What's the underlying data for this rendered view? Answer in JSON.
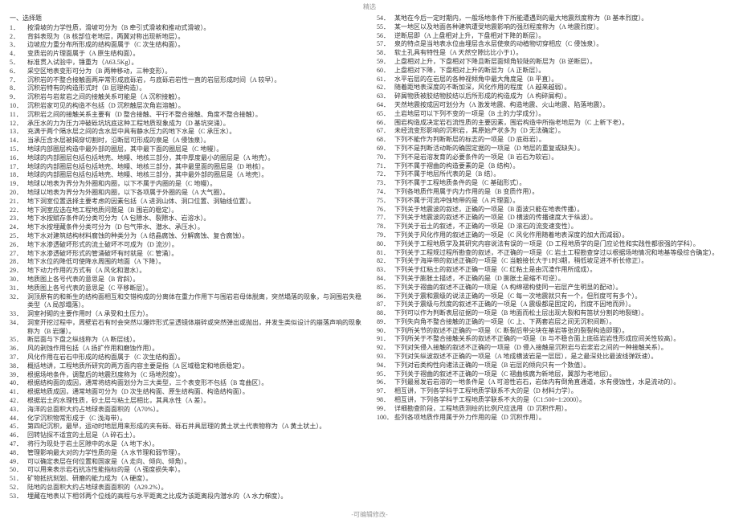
{
  "header_text": "精选",
  "footer_text": "-可编辑修改-",
  "section_title": "一、选择题",
  "items": [
    {
      "n": "1．",
      "t": "按滑坡的力学性质，滑坡可分为（B 牵引式滑坡和推动式滑坡）。"
    },
    {
      "n": "2．",
      "t": "背斜表现为（B 核部位老地层，两翼对称出现新地层）。"
    },
    {
      "n": "3．",
      "t": "边坡应力重分布所形成的结构面属于（C 次生结构面）。"
    },
    {
      "n": "4．",
      "t": "变质岩的片理面属于（A 原生结构面）。"
    },
    {
      "n": "5．",
      "t": "标准贯入试验中，锤重为（A63.5Kg）。"
    },
    {
      "n": "6．",
      "t": "采空区地表变形可分为（B 两种移动，三种变形）。"
    },
    {
      "n": "7．",
      "t": "沉积岩的不整合接触面两岸常形成底砾岩，与底砾岩岩性一直的岩层形成时间（A 较早）。"
    },
    {
      "n": "8．",
      "t": "沉积岩特有的构造形式时（B 层理构造）。"
    },
    {
      "n": "9．",
      "t": "沉积岩与岩浆岩之间的接触关系可能是（A 沉积接触）。"
    },
    {
      "n": "10．",
      "t": "沉积岩家可见的构造不包括（D 沉积触层次角岩溶触）。"
    },
    {
      "n": "11．",
      "t": "沉积岩之间的接触关系主要有（D 整合接触、平行不整合接触、角度不整合接触）。"
    },
    {
      "n": "12．",
      "t": "承压水的力为压力冲破砾坑坑底这种工程地质现象成为（D 基坑突涌）。"
    },
    {
      "n": "13．",
      "t": "充满于两个隔水层之间的含水层中具有静水压力的地下水是（C 承压水）。"
    },
    {
      "n": "14．",
      "t": "当承压含水层被揭穿切割时，沿断层可形成的泉是（A 侵蚀泉）。"
    },
    {
      "n": "15．",
      "t": "地球内部圈层构造中最外部的圈层，其中最下面的圈层是（C 地幔）。"
    },
    {
      "n": "16．",
      "t": "地球的内部圈层包括包括地壳、地幔、地核三部分，其中厚度最小的圈层是（A 地壳）。"
    },
    {
      "n": "17．",
      "t": "地球的内部圈层包括包括地壳、地幔、地核三部分，其中最里面的圈层是（D 地核）。"
    },
    {
      "n": "18．",
      "t": "地球的内部圈层包括包括地壳、地幔、地核三部分，其中最外部的圈层是（A 地壳）。"
    },
    {
      "n": "19．",
      "t": "地球以地表为界分为外圈和内圈，以下不属于内圈的是（C 地幔）。"
    },
    {
      "n": "20．",
      "t": "地球以地表为界分为外圈和内圈，以下各项属于外圈的是（A 大气圈）。"
    },
    {
      "n": "21．",
      "t": "地下洞室位置选择主要考虑的因素包括（A 进洞山体、洞口位置、洞轴线位置）。"
    },
    {
      "n": "22．",
      "t": "地下洞室应选在地工程地质问题是（B 围岩的稳定）。"
    },
    {
      "n": "23．",
      "t": "地下水按赋存条件的分类可分为（A 包隙水、裂隙水、岩溶水）。"
    },
    {
      "n": "24．",
      "t": "地下水按埋藏条件分类可分为（D 包气带水、潜水、承压水）。"
    },
    {
      "n": "25．",
      "t": "地下水对建筑结构材料腐蚀的种类分为（A 结晶腐蚀、分解腐蚀、复合腐蚀）。"
    },
    {
      "n": "26．",
      "t": "地下水渗透破坏形式的流土破坏不可成为（D 流沙）。"
    },
    {
      "n": "27．",
      "t": "地下水渗透破坏形式的管涌破坏有时就是（C 管涌）。"
    },
    {
      "n": "28．",
      "t": "地下水位的降低可使降水周围的地面（A 下降）。"
    },
    {
      "n": "29．",
      "t": "地下动力作用的方式有（A 风化和潜水）。"
    },
    {
      "n": "30．",
      "t": "地质图上各号代表的意思是（B 背斜）。"
    },
    {
      "n": "31．",
      "t": "地质图上各号代表的意思是（C 平移断层）。"
    },
    {
      "n": "32．",
      "t": "洞顶原有的和新生的结构面相互和交错构成的分离体在重力作用下与围岩岩母体脱离，突然塌落的现象，与洞围岩失稳类型（A 局部塌落）。"
    },
    {
      "n": "33．",
      "t": "洞室衬砌的主要作用时（A 承受和土压力）。"
    },
    {
      "n": "34．",
      "t": "洞室开挖过程中，周壁岩石有时会突然以爆炸形式呈透镜体崩碎或突然弹出或抛出，并发生类似设计的崩落声响的现象称为（B 岩爆）。"
    },
    {
      "n": "35．",
      "t": "断层面与下盘之纵线称为（A 断层线）。"
    },
    {
      "n": "36．",
      "t": "风的剥蚀作用包括（A 扬扩作用和磨蚀作用）。"
    },
    {
      "n": "37．",
      "t": "风化作用在岩石中形成的结构面属于（C 次生结构面）。"
    },
    {
      "n": "38．",
      "t": "概括地讲，工程地质所研究的两方面内容主要是指（A 区域稳定和地质稳定）。"
    },
    {
      "n": "39．",
      "t": "根据场地条件，调整后的地震烈度称为（C 场地烈度）。"
    },
    {
      "n": "40．",
      "t": "根据结构面的成因，通常将结构面划分为三大类型，三个表变形不包括（B 弯曲区）。"
    },
    {
      "n": "41．",
      "t": "根据地质成因，通常地面可分为（D 次生结构面、原生结构面、构造结构面）。"
    },
    {
      "n": "42．",
      "t": "根据岩土的水理性质，砂土层与粘土层相比，其具水性（A 差）。"
    },
    {
      "n": "43．",
      "t": "海洋的总面积大约占地球表面面积的（A70%）。"
    },
    {
      "n": "44．",
      "t": "化学沉积物常形成于（C 浅海带）。"
    },
    {
      "n": "45．",
      "t": "第四纪沉积，最早，运动时地层用来形成的夹有砾、砾石并具层理的黄土状土代表物称为（A 黄土状土）。"
    },
    {
      "n": "46．",
      "t": "回转钻探不适宜的土层是（A 碎石土）。"
    },
    {
      "n": "47．",
      "t": "将行为现处于岩土区隙中的水是（A 地下水）。"
    },
    {
      "n": "48．",
      "t": "管理影响最大对的力学性质的是（A 水节理和弱节理）。"
    },
    {
      "n": "49．",
      "t": "可以确定表层在何位置和国家是（A 走向、倾向、倾角）。"
    },
    {
      "n": "50．",
      "t": "可以用来表示岩石抗冻性能指标的是（A 强度损失率）。"
    },
    {
      "n": "51．",
      "t": "矿物抵抗刻划、研磨的能力成为（A 硬度）。"
    },
    {
      "n": "52．",
      "t": "陆地的总面积大约占地球表面面积的（A29.2%）。"
    },
    {
      "n": "53．",
      "t": "埋藏在地表以下相邻两个位线的高程与水平距离之比成为该距离段内潜水的（A 水力梯度）。"
    },
    {
      "n": "54．",
      "t": "某地在今后一定时期内，一般场地条件下所能遭遇到的最大地震烈度称为（B 基本烈度）。"
    },
    {
      "n": "55．",
      "t": "某一地区以及地面各种建筑遭受地震影响的强烈程度称为（A 地震烈度）。"
    },
    {
      "n": "56．",
      "t": "逆断层即（A 上盘相对上升，下盘相对下降的断层）。"
    },
    {
      "n": "57．",
      "t": "泉的特点是当地表水位由埋层含水层使泉的动植物切穿相应（C 侵蚀泉）。"
    },
    {
      "n": "58．",
      "t": "软土孔具有特性是（A 天然空隙比比小于1）。"
    },
    {
      "n": "59．",
      "t": "上盘相对上升，下盘相对下降且断层面倾角较陡的断层为（B 逆断层）。"
    },
    {
      "n": "60．",
      "t": "上盘相对下降，下盘相对上升的断层为（A 正断层）。"
    },
    {
      "n": "61．",
      "t": "水平岩层的在岩层的各种视倾角中最大角度是（B 平直）。"
    },
    {
      "n": "62．",
      "t": "随着距地表深度的不断加深，风化作用的程度（A 越来越弱）。"
    },
    {
      "n": "63．",
      "t": "碎屑物质被胶结物胶结以后所形成的构造成为（A 构碎屑构）。"
    },
    {
      "n": "64．",
      "t": "天然地震按成因可划分为（A 激发地震、构造地震、火山地震、陷落地震）。"
    },
    {
      "n": "65．",
      "t": "土岩地层可以下列不变的一项是（B 土的力学成分）。"
    },
    {
      "n": "66．",
      "t": "围岩构造成决定岩石流性质的主要因素，围岩构造中所指老地层为（C 上新下老）。"
    },
    {
      "n": "67．",
      "t": "未经流变形影响的沉积岩，其原始产状多为（D 无法确定）。"
    },
    {
      "n": "68．",
      "t": "下列不能作为判断断层的标志的一项是（D 底砾岩）。"
    },
    {
      "n": "69．",
      "t": "下列不是判断活动断的确固定据的一项是（D 地层的重复或缺失）。"
    },
    {
      "n": "70．",
      "t": "下列不是岩溶发育的必要条件的一项是（B 岩石为软岩）。"
    },
    {
      "n": "71．",
      "t": "下列不属于褶曲的构造要素的是（B 结构）。"
    },
    {
      "n": "72．",
      "t": "下列不属于地层所代表的是（B 结）。"
    },
    {
      "n": "73．",
      "t": "下列不属于工程地质条件的是（C 基础形式）。"
    },
    {
      "n": "74．",
      "t": "下列各地质作用属于内力作用的是（B 变质作用）。"
    },
    {
      "n": "75．",
      "t": "下列不属于河流冲蚀地带的是（A 片理面）。"
    },
    {
      "n": "76．",
      "t": "下列关于地震波的叙述，正确的一项是（B 面波只能在地表传播）。"
    },
    {
      "n": "77．",
      "t": "下列关于地震波的叙述不正确的一项是（D 横波的传播速度大于纵波）。"
    },
    {
      "n": "78．",
      "t": "下列关于岩土的叙述，不正确的一项是（D 滚石的流变速变性）。"
    },
    {
      "n": "79．",
      "t": "下列关于风化作用的叙述正确的一项是（C 风化作用随着地表深度的加大而减弱）。"
    },
    {
      "n": "80．",
      "t": "下列关于工程地质学及其研究内容说法有误的一项是（D 工程地质学的是门应论性和实践性都很强的学科）。"
    },
    {
      "n": "81．",
      "t": "下列关于工程规过程所勘查的叙述，不正确的一项是（C 岩土工程勘查穿过以根据场地情况和地基等级综合确定）。"
    },
    {
      "n": "82．",
      "t": "下列关于海岸带的叙述正确的一项是（C 当触接长大于1时3期，稍低坡足进不析长修正）。"
    },
    {
      "n": "83．",
      "t": "下列关于红粘土的叙述不正确一项是（C 红粘土是由沉渣作用所成成）。"
    },
    {
      "n": "84．",
      "t": "下列关于膨胀土描述，不正确的是（D 膨胀土是缩不可逆）。"
    },
    {
      "n": "85．",
      "t": "下列关于褶曲的叙述不正确的一项是（A 构绵褶构使同一岩层产生明显的配动）。"
    },
    {
      "n": "86．",
      "t": "下列关于震和震级的说法正确的一项是（C 每一次地震就只有一个，但烈度可有多个）。"
    },
    {
      "n": "87．",
      "t": "下列关于震级与烈度的叙述不正确的一项是（A 震级都是固定的，烈度不因地而异）。"
    },
    {
      "n": "88．",
      "t": "下列可以作为判断表层征据的一项是（B 地面而松土层出现大裂和有笛状分割的地裂缝）。"
    },
    {
      "n": "89．",
      "t": "下列失向角不整合接触的正确的一项是（C 上、下两套岩层之间无沉积间断）。"
    },
    {
      "n": "90．",
      "t": "下列所关节的叙述不正确的一项是（C 断裂后带尖块在基岩等张的裂裂构造即理）。"
    },
    {
      "n": "91．",
      "t": "下列所关于不整合接触关系的叙述不正确的一项是（B 与不稳合面上底砾岩岩性形成应间关性较高）。"
    },
    {
      "n": "92．",
      "t": "下列对矢侵入接触的叙述不正确的一项是（D 侵入接触是沉积岩与岩浆岩之间的一种接触关系）。"
    },
    {
      "n": "93．",
      "t": "下列对矢纵波叙述不正确的一项是（A 地成横波岩是一层层），是之最深处比最波线弹跃速）。"
    },
    {
      "n": "94．",
      "t": "下列对岩类构性向诸法正确的一项是（B 岩层的倾向只有一个数值）。"
    },
    {
      "n": "95．",
      "t": "下列关于褶曲的叙述不正确的一项是（C 褶曲核腐为新地层，翼部为老地层）。"
    },
    {
      "n": "96．",
      "t": "下列最易发岩岩溶的一地条件是（A 可溶性岩石，岩体内有倒角直通道，水有侵蚀性，水是流动的）。"
    },
    {
      "n": "97．",
      "t": "相互讲，下列各学科于工程地质学联系不大的是（D 材料力学）。"
    },
    {
      "n": "98．",
      "t": "相互讲，下列各学科于工程地质学联系不大的是（C1:500~1:2000）。"
    },
    {
      "n": "99．",
      "t": "详细勘查阶段，工程地质测绘的比例尺应选用（D 沉积作用）。"
    },
    {
      "n": "100．",
      "t": "些列各项地质作用属于外力作用的是（D 沉积作用）。"
    }
  ]
}
